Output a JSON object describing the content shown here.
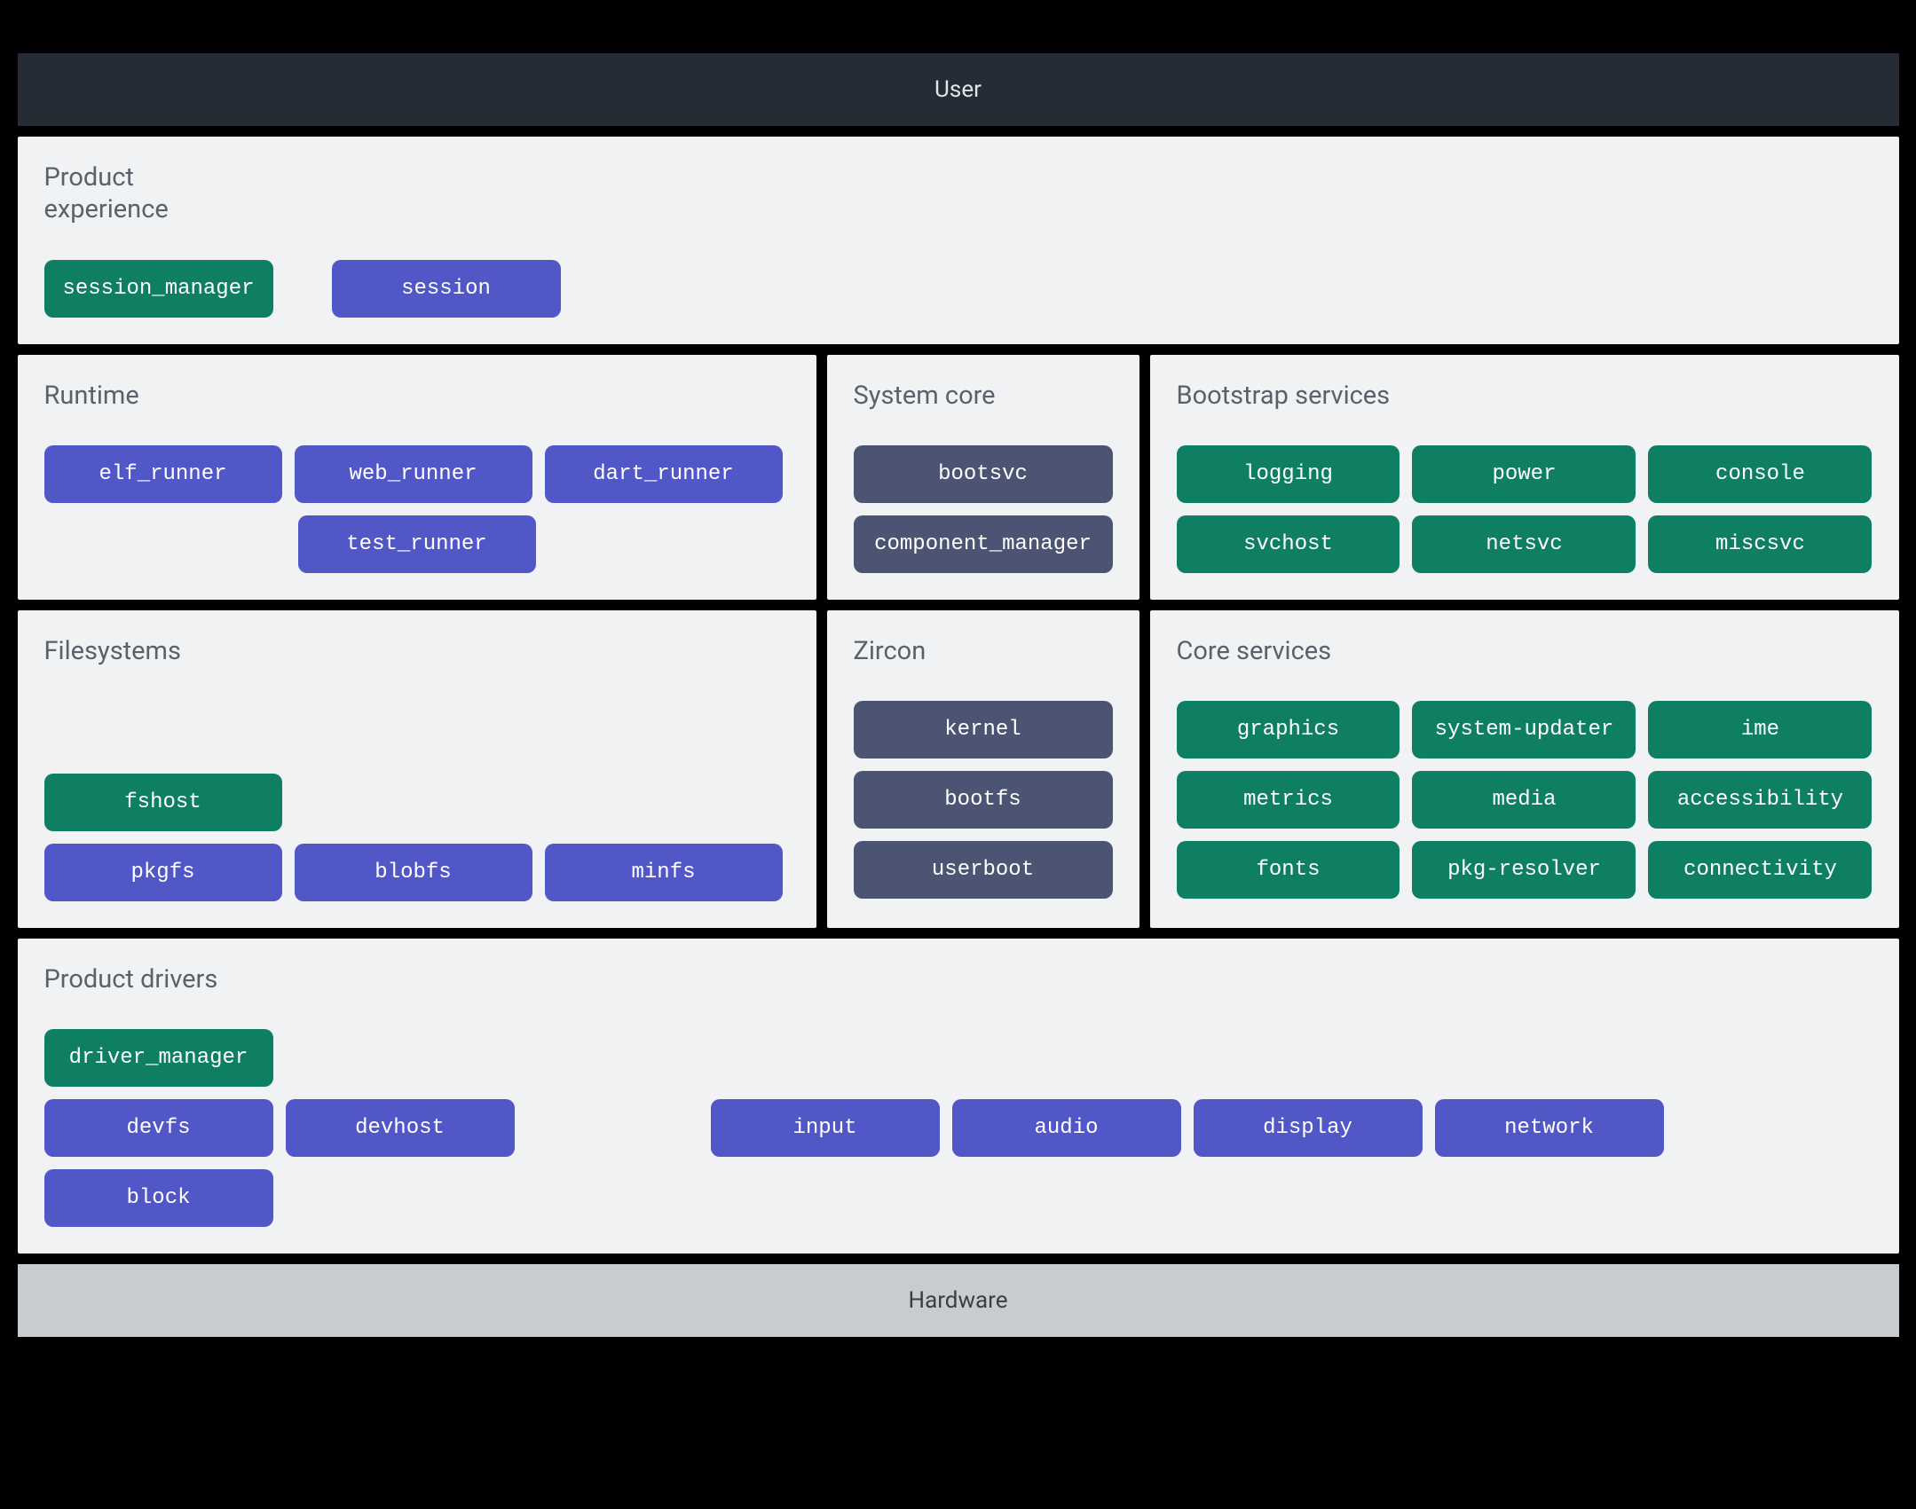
{
  "top_banner": "User",
  "bottom_banner": "Hardware",
  "product_experience": {
    "title": "Product\nexperience",
    "items": [
      {
        "label": "session_manager",
        "color": "green"
      },
      {
        "label": "session",
        "color": "blue"
      }
    ]
  },
  "runtime": {
    "title": "Runtime",
    "row1": [
      {
        "label": "elf_runner",
        "color": "blue"
      },
      {
        "label": "web_runner",
        "color": "blue"
      },
      {
        "label": "dart_runner",
        "color": "blue"
      }
    ],
    "row2": [
      {
        "label": "test_runner",
        "color": "blue"
      }
    ]
  },
  "system_core": {
    "title": "System core",
    "items": [
      {
        "label": "bootsvc",
        "color": "slate"
      },
      {
        "label": "component_manager",
        "color": "slate"
      }
    ]
  },
  "bootstrap": {
    "title": "Bootstrap services",
    "items": [
      {
        "label": "logging",
        "color": "green"
      },
      {
        "label": "power",
        "color": "green"
      },
      {
        "label": "console",
        "color": "green"
      },
      {
        "label": "svchost",
        "color": "green"
      },
      {
        "label": "netsvc",
        "color": "green"
      },
      {
        "label": "miscsvc",
        "color": "green"
      }
    ]
  },
  "filesystems": {
    "title": "Filesystems",
    "row1": [
      {
        "label": "fshost",
        "color": "green"
      }
    ],
    "row2": [
      {
        "label": "pkgfs",
        "color": "blue"
      },
      {
        "label": "blobfs",
        "color": "blue"
      },
      {
        "label": "minfs",
        "color": "blue"
      }
    ]
  },
  "zircon": {
    "title": "Zircon",
    "items": [
      {
        "label": "kernel",
        "color": "slate"
      },
      {
        "label": "bootfs",
        "color": "slate"
      },
      {
        "label": "userboot",
        "color": "slate"
      }
    ]
  },
  "core_services": {
    "title": "Core services",
    "items": [
      {
        "label": "graphics",
        "color": "green"
      },
      {
        "label": "system-updater",
        "color": "green"
      },
      {
        "label": "ime",
        "color": "green"
      },
      {
        "label": "metrics",
        "color": "green"
      },
      {
        "label": "media",
        "color": "green"
      },
      {
        "label": "accessibility",
        "color": "green"
      },
      {
        "label": "fonts",
        "color": "green"
      },
      {
        "label": "pkg-resolver",
        "color": "green"
      },
      {
        "label": "connectivity",
        "color": "green"
      }
    ]
  },
  "product_drivers": {
    "title": "Product drivers",
    "row1": [
      {
        "label": "driver_manager",
        "color": "green"
      }
    ],
    "row2_left": [
      {
        "label": "devfs",
        "color": "blue"
      },
      {
        "label": "devhost",
        "color": "blue"
      }
    ],
    "row2_right": [
      {
        "label": "input",
        "color": "blue"
      },
      {
        "label": "audio",
        "color": "blue"
      },
      {
        "label": "display",
        "color": "blue"
      },
      {
        "label": "network",
        "color": "blue"
      },
      {
        "label": "block",
        "color": "blue"
      }
    ]
  }
}
